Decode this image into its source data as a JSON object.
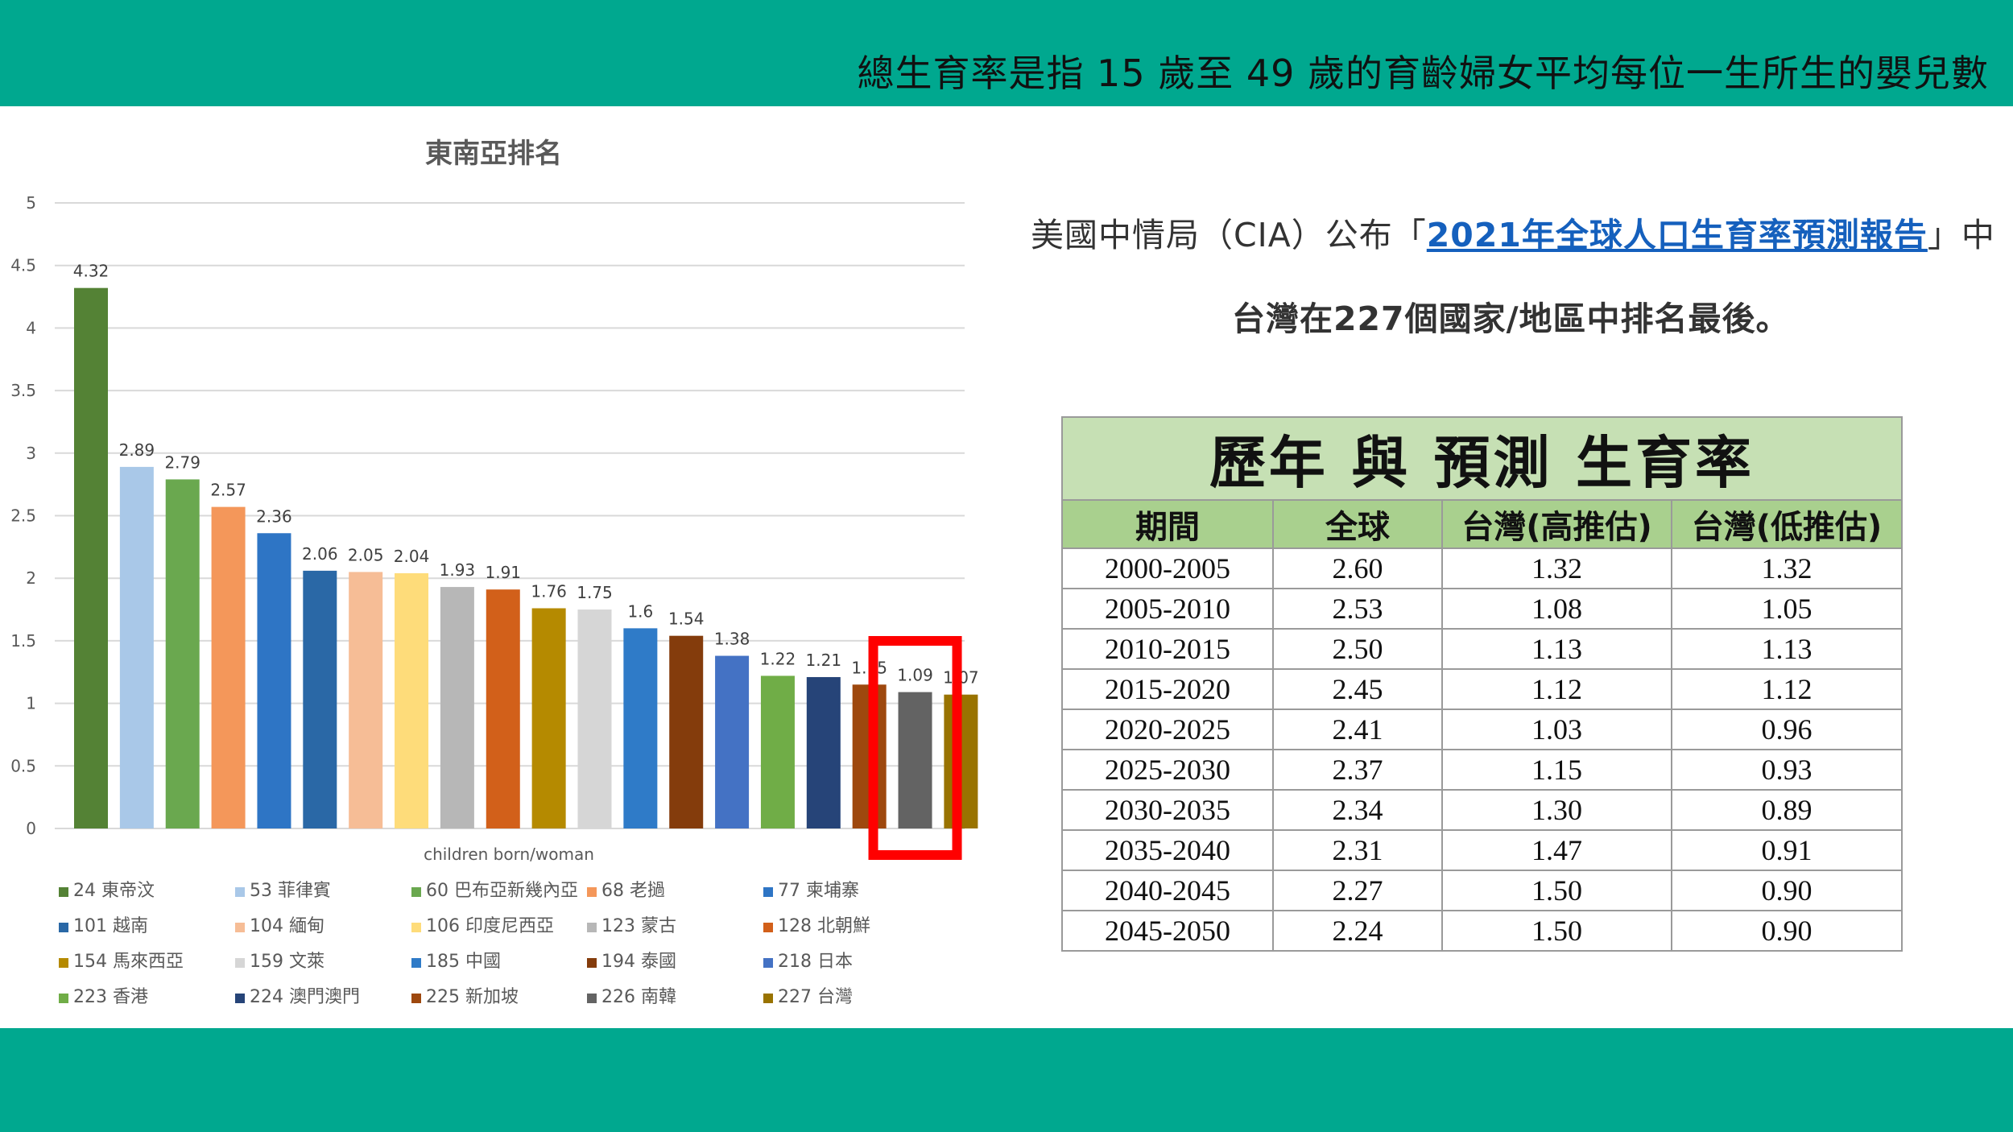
{
  "headline": "總生育率是指 15 歲至 49 歲的育齡婦女平均每位一生所生的嬰兒數",
  "colors": {
    "band": "#00a88f",
    "highlight_box": "#ff0000",
    "link": "#1560bd"
  },
  "cia": {
    "prefix": "美國中情局（CIA）公布「",
    "link_text": "2021年全球人口生育率預測報告",
    "suffix": "」中",
    "line2": "台灣在227個國家/地區中排名最後。"
  },
  "table": {
    "title": "歷年 與 預測 生育率",
    "headers": [
      "期間",
      "全球",
      "台灣(高推估)",
      "台灣(低推估)"
    ],
    "rows": [
      [
        "2000-2005",
        "2.60",
        "1.32",
        "1.32"
      ],
      [
        "2005-2010",
        "2.53",
        "1.08",
        "1.05"
      ],
      [
        "2010-2015",
        "2.50",
        "1.13",
        "1.13"
      ],
      [
        "2015-2020",
        "2.45",
        "1.12",
        "1.12"
      ],
      [
        "2020-2025",
        "2.41",
        "1.03",
        "0.96"
      ],
      [
        "2025-2030",
        "2.37",
        "1.15",
        "0.93"
      ],
      [
        "2030-2035",
        "2.34",
        "1.30",
        "0.89"
      ],
      [
        "2035-2040",
        "2.31",
        "1.47",
        "0.91"
      ],
      [
        "2040-2045",
        "2.27",
        "1.50",
        "0.90"
      ],
      [
        "2045-2050",
        "2.24",
        "1.50",
        "0.90"
      ]
    ]
  },
  "chart_data": {
    "type": "bar",
    "title": "東南亞排名",
    "xlabel": "children born/woman",
    "ylabel": "",
    "ylim": [
      0,
      5
    ],
    "yticks": [
      "0",
      "0.5",
      "1",
      "1.5",
      "2",
      "2.5",
      "3",
      "3.5",
      "4",
      "4.5",
      "5"
    ],
    "grid": true,
    "legend_position": "bottom",
    "highlight_index": 18,
    "series": [
      {
        "name": "24 東帝汶",
        "value": 4.32,
        "label": "4.32",
        "color": "#548235"
      },
      {
        "name": "53 菲律賓",
        "value": 2.89,
        "label": "2.89",
        "color": "#a9c8e8"
      },
      {
        "name": "60 巴布亞新幾內亞",
        "value": 2.79,
        "label": "2.79",
        "color": "#6aa84f"
      },
      {
        "name": "68 老撾",
        "value": 2.57,
        "label": "2.57",
        "color": "#f4975a"
      },
      {
        "name": "77 柬埔寨",
        "value": 2.36,
        "label": "2.36",
        "color": "#2e75c5"
      },
      {
        "name": "101 越南",
        "value": 2.06,
        "label": "2.06",
        "color": "#2a68a6"
      },
      {
        "name": "104 緬甸",
        "value": 2.05,
        "label": "2.05",
        "color": "#f6bd96"
      },
      {
        "name": "106 印度尼西亞",
        "value": 2.04,
        "label": "2.04",
        "color": "#fedc7a"
      },
      {
        "name": "123 蒙古",
        "value": 1.93,
        "label": "1.93",
        "color": "#b7b7b7"
      },
      {
        "name": "128 北朝鮮",
        "value": 1.91,
        "label": "1.91",
        "color": "#d2601a"
      },
      {
        "name": "154 馬來西亞",
        "value": 1.76,
        "label": "1.76",
        "color": "#b58a00"
      },
      {
        "name": "159 文萊",
        "value": 1.75,
        "label": "1.75",
        "color": "#d6d6d6"
      },
      {
        "name": "185 中國",
        "value": 1.6,
        "label": "1.6",
        "color": "#2f7bc8"
      },
      {
        "name": "194 泰國",
        "value": 1.54,
        "label": "1.54",
        "color": "#843c0c"
      },
      {
        "name": "218 日本",
        "value": 1.38,
        "label": "1.38",
        "color": "#4472c4"
      },
      {
        "name": "223 香港",
        "value": 1.22,
        "label": "1.22",
        "color": "#70ad47"
      },
      {
        "name": "224 澳門澳門",
        "value": 1.21,
        "label": "1.21",
        "color": "#264478"
      },
      {
        "name": "225 新加坡",
        "value": 1.15,
        "label": "1.15",
        "color": "#9e480e"
      },
      {
        "name": "226 南韓",
        "value": 1.09,
        "label": "1.09",
        "color": "#636363"
      },
      {
        "name": "227 台灣",
        "value": 1.07,
        "label": "1.07",
        "color": "#997300"
      }
    ]
  }
}
